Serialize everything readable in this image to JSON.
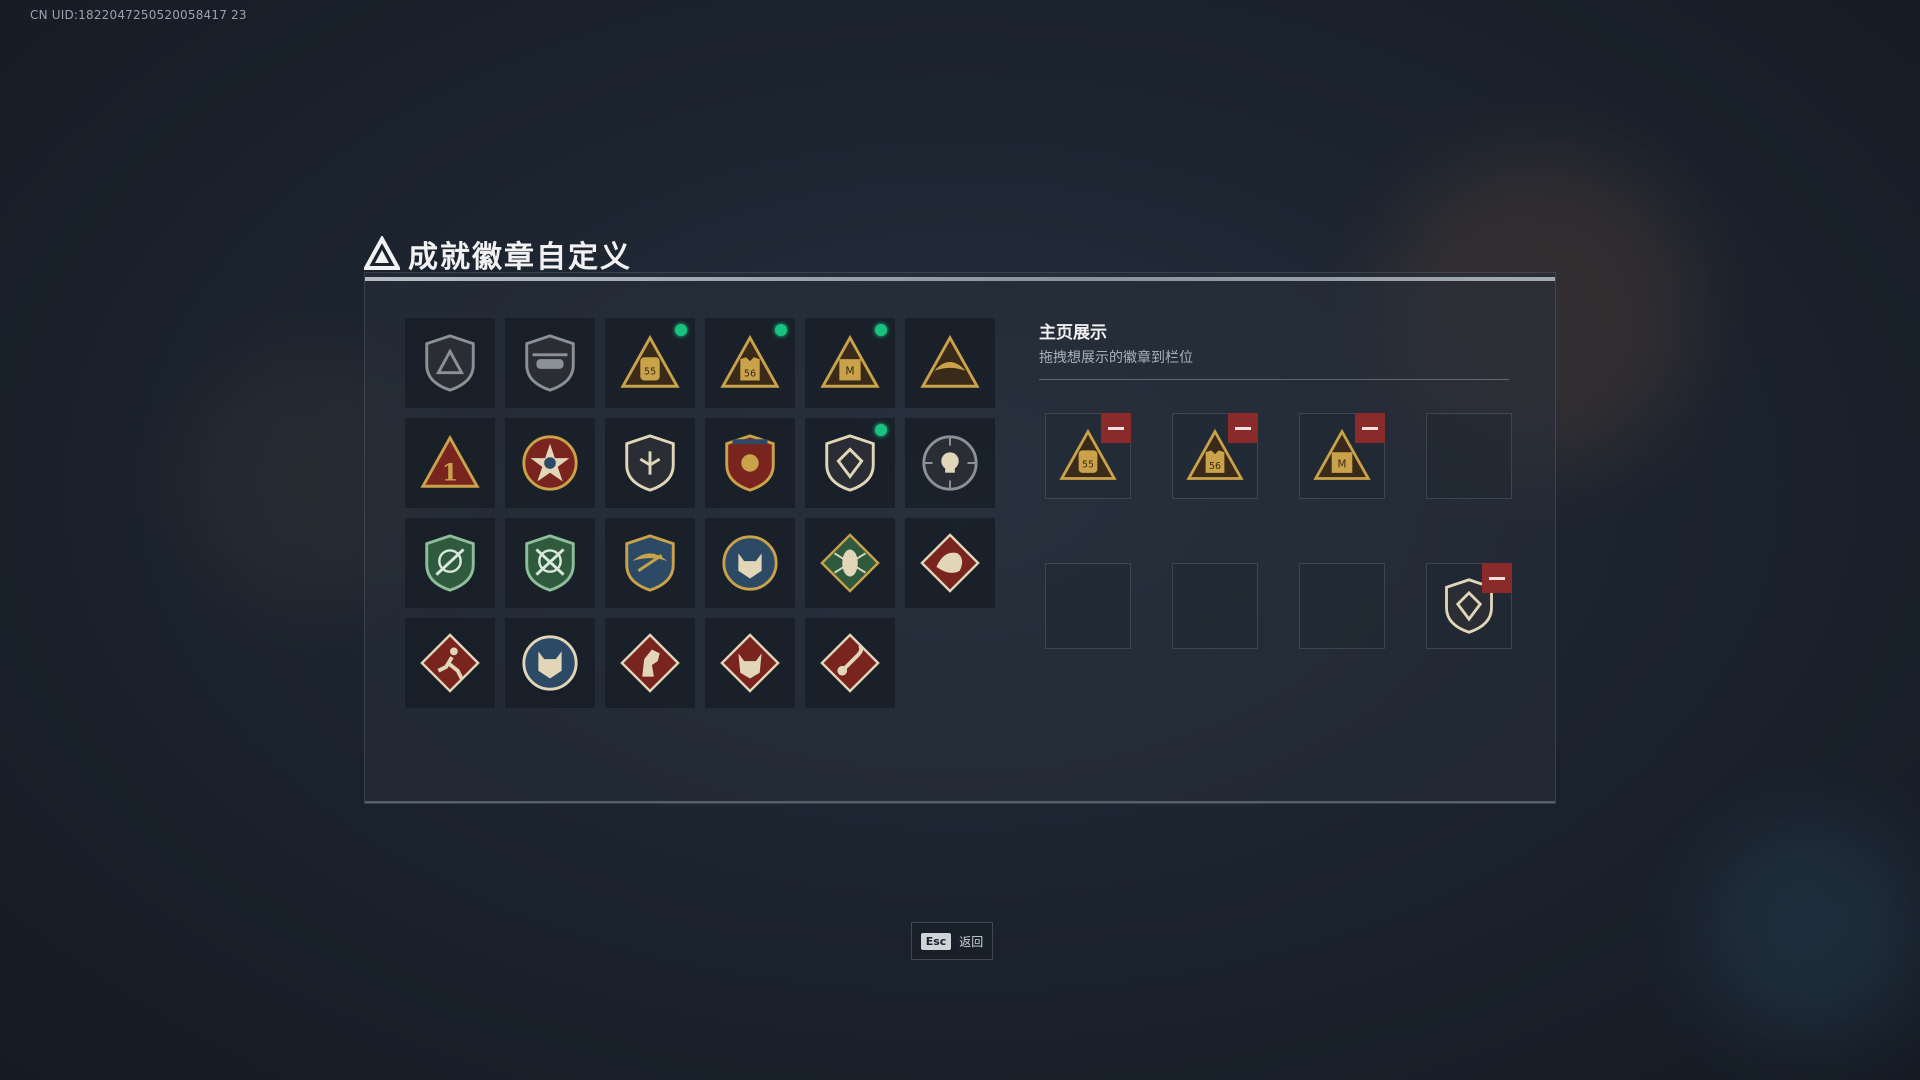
{
  "uid": "CN UID:1822047250520058417 23",
  "title": "成就徽章自定义",
  "showcase": {
    "title": "主页展示",
    "subtitle": "拖拽想展示的徽章到栏位"
  },
  "badges": [
    {
      "icon": "grey-shield-triangle-icon",
      "new": false
    },
    {
      "icon": "grey-helicopter-shield-icon",
      "new": false
    },
    {
      "icon": "gold-backpack-55-triangle-icon",
      "new": true
    },
    {
      "icon": "gold-vest-56-triangle-icon",
      "new": true
    },
    {
      "icon": "gold-m-case-triangle-icon",
      "new": true
    },
    {
      "icon": "gold-phoenix-triangle-icon",
      "new": false
    },
    {
      "icon": "red-triangle-number-1-icon",
      "new": false
    },
    {
      "icon": "star-medal-icon",
      "new": false
    },
    {
      "icon": "shield-wings-icon",
      "new": false
    },
    {
      "icon": "crest-stars-icon",
      "new": false
    },
    {
      "icon": "gem-shield-icon",
      "new": true
    },
    {
      "icon": "skull-crosshair-icon",
      "new": false
    },
    {
      "icon": "green-rifle-shield-icon",
      "new": false
    },
    {
      "icon": "green-crossed-rifles-shield-icon",
      "new": false
    },
    {
      "icon": "gold-eagle-shield-icon",
      "new": false
    },
    {
      "icon": "wolf-circle-icon",
      "new": false
    },
    {
      "icon": "green-insect-diamond-icon",
      "new": false
    },
    {
      "icon": "red-dragon-diamond-icon",
      "new": false
    },
    {
      "icon": "red-runner-diamond-icon",
      "new": false
    },
    {
      "icon": "blue-cat-circle-icon",
      "new": false
    },
    {
      "icon": "red-horse-diamond-icon",
      "new": false
    },
    {
      "icon": "red-wolf-diamond-icon",
      "new": false
    },
    {
      "icon": "red-scorpion-diamond-icon",
      "new": false
    }
  ],
  "slots": [
    {
      "icon": "gold-backpack-55-triangle-icon",
      "filled": true
    },
    {
      "icon": "gold-vest-56-triangle-icon",
      "filled": true
    },
    {
      "icon": "gold-m-case-triangle-icon",
      "filled": true
    },
    {
      "icon": "",
      "filled": false
    },
    {
      "icon": "",
      "filled": false
    },
    {
      "icon": "",
      "filled": false
    },
    {
      "icon": "",
      "filled": false
    },
    {
      "icon": "gem-shield-icon",
      "filled": true
    }
  ],
  "backpack_level": "55",
  "vest_level": "56",
  "case_letter": "M",
  "number_one": "1",
  "esc": {
    "key": "Esc",
    "label": "返回"
  },
  "colors": {
    "new_dot": "#16c47f",
    "remove": "#8a2a2a",
    "gold": "#c9a24a",
    "red_badge": "#7a2420",
    "green_badge": "#2f5a3e"
  }
}
